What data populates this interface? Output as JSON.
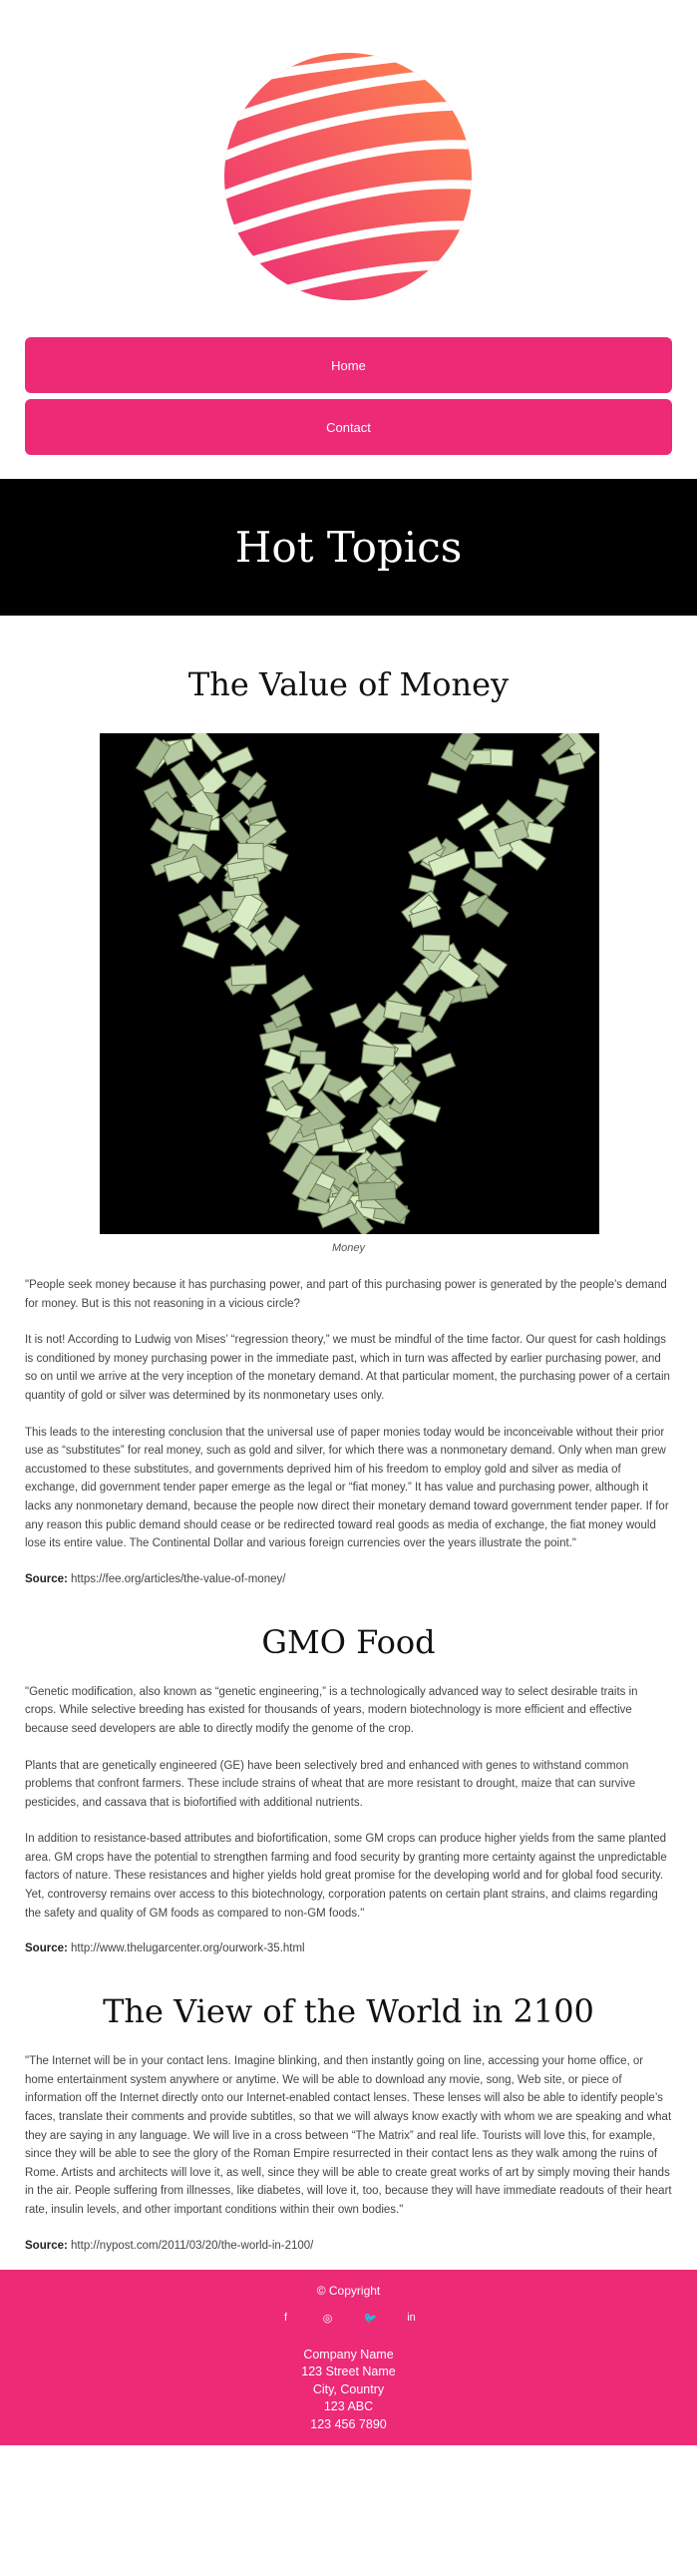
{
  "nav": {
    "home": "Home",
    "contact": "Contact"
  },
  "hero": {
    "title": "Hot Topics"
  },
  "sections": [
    {
      "title": "The Value of Money",
      "image_caption": "Money",
      "paragraphs": [
        "\"People seek money because it has purchasing power, and part of this purchasing power is generated by the people’s demand for money. But is this not reasoning in a vicious circle?",
        "It is not! According to Ludwig von Mises’ “regression theory,” we must be mindful of the time factor. Our quest for cash holdings is conditioned by money purchasing power in the immediate past, which in turn was affected by earlier purchasing power, and so on until we arrive at the very inception of the monetary demand. At that particular moment, the purchasing power of a certain quantity of gold or silver was determined by its nonmonetary uses only.",
        "This leads to the interesting conclusion that the universal use of paper monies today would be inconceivable without their prior use as “substitutes” for real money, such as gold and silver, for which there was a nonmonetary demand. Only when man grew accustomed to these substitutes, and governments deprived him of his freedom to employ gold and silver as media of exchange, did government tender paper emerge as the legal or “fiat money.” It has value and purchasing power, although it lacks any nonmonetary demand, because the people now direct their monetary demand toward government tender paper. If for any reason this public demand should cease or be redirected toward real goods as media of exchange, the fiat money would lose its entire value. The Continental Dollar and various foreign currencies over the years illustrate the point.\""
      ],
      "source_label": "Source:",
      "source_url": "https://fee.org/articles/the-value-of-money/"
    },
    {
      "title": "GMO Food",
      "paragraphs": [
        "\"Genetic modification, also known as “genetic engineering,” is a technologically advanced way to select desirable traits in crops. While selective breeding has existed for thousands of years, modern biotechnology is more efficient and effective because seed developers are able to directly modify the genome of the crop.",
        "Plants that are genetically engineered (GE) have been selectively bred and enhanced with genes to withstand common problems that confront farmers. These include strains of wheat that are more resistant to drought, maize that can survive pesticides, and cassava that is biofortified with additional nutrients.",
        "In addition to resistance-based attributes and biofortification, some GM crops can produce higher yields from the same planted area. GM crops have the potential to strengthen farming and food security by granting more certainty against the unpredictable factors of nature. These resistances and higher yields hold great promise for the developing world and for global food security. Yet, controversy remains over access to this biotechnology, corporation patents on certain plant strains, and claims regarding the safety and quality of GM foods as compared to non-GM foods.\""
      ],
      "source_label": "Source:",
      "source_url": "http://www.thelugarcenter.org/ourwork-35.html"
    },
    {
      "title": "The View of the World in 2100",
      "paragraphs": [
        "\"The Internet will be in your contact lens. Imagine blinking, and then instantly going on line, accessing your home office, or home entertainment system anywhere or anytime. We will be able to download any movie, song, Web site, or piece of information off the Internet directly onto our Internet-enabled contact lenses. These lenses will also be able to identify people’s faces, translate their comments and provide subtitles, so that we will always know exactly with whom we are speaking and what they are saying in any language. We will live in a cross between “The Matrix” and real life. Tourists will love this, for example, since they will be able to see the glory of the Roman Empire resurrected in their contact lens as they walk among the ruins of Rome. Artists and architects will love it, as well, since they will be able to create great works of art by simply moving their hands in the air. People suffering from illnesses, like diabetes, will love it, too, because they will have immediate readouts of their heart rate, insulin levels, and other important conditions within their own bodies.\""
      ],
      "source_label": "Source:",
      "source_url": "http://nypost.com/2011/03/20/the-world-in-2100/"
    }
  ],
  "footer": {
    "copyright": "© Copyright",
    "social": [
      {
        "name": "facebook-icon",
        "glyph": "f"
      },
      {
        "name": "instagram-icon",
        "glyph": "◎"
      },
      {
        "name": "twitter-icon",
        "glyph": "🐦"
      },
      {
        "name": "linkedin-icon",
        "glyph": "in"
      }
    ],
    "address": [
      "Company Name",
      "123 Street Name",
      "City, Country",
      "123 ABC",
      "123 456 7890"
    ]
  },
  "colors": {
    "accent": "#ec2a76",
    "logo_from": "#ec2a76",
    "logo_to": "#ff8a4c"
  }
}
